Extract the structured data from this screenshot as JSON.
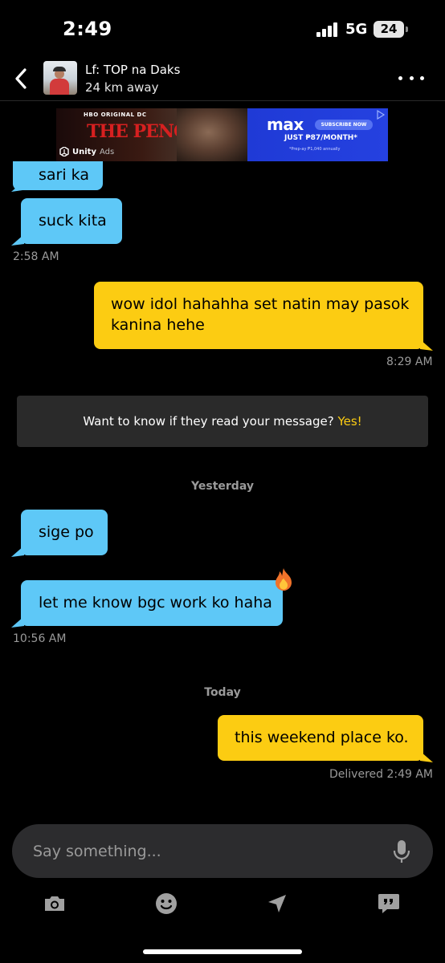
{
  "status_bar": {
    "time": "2:49",
    "network": "5G",
    "battery": "24"
  },
  "header": {
    "name": "Lf: TOP na Daks",
    "distance": "24 km away"
  },
  "ad": {
    "brand_top": "HBO ORIGINAL DC",
    "title": "THE PENGUIN",
    "provider": "Unity",
    "ads_label": "Ads",
    "service": "max",
    "cta": "SUBSCRIBE NOW",
    "price": "JUST ₱87/MONTH*",
    "fine_print": "*Prep-ay ₱1,040 annually"
  },
  "messages": {
    "partial": "sari ka",
    "m1": "suck kita",
    "m1_time": "2:58 AM",
    "m2": "wow idol hahahha set natin may pasok kanina hehe",
    "m2_time": "8:29 AM",
    "read_prompt": "Want to know if they read your message?",
    "read_yes": "Yes!",
    "day_yesterday": "Yesterday",
    "m3": "sige po",
    "m4": "let me know bgc work ko haha",
    "m4_time": "10:56 AM",
    "day_today": "Today",
    "m5": "this weekend place ko.",
    "m5_status": "Delivered 2:49 AM"
  },
  "composer": {
    "placeholder": "Say something..."
  },
  "colors": {
    "incoming_bubble": "#5ec8f7",
    "outgoing_bubble": "#fccc12",
    "background": "#000000",
    "accent_yes": "#fccc12"
  },
  "icons": [
    "back-chevron-icon",
    "more-dots-icon",
    "mic-icon",
    "camera-icon",
    "emoji-icon",
    "location-arrow-icon",
    "quote-phrases-icon",
    "fire-emoji-icon"
  ]
}
